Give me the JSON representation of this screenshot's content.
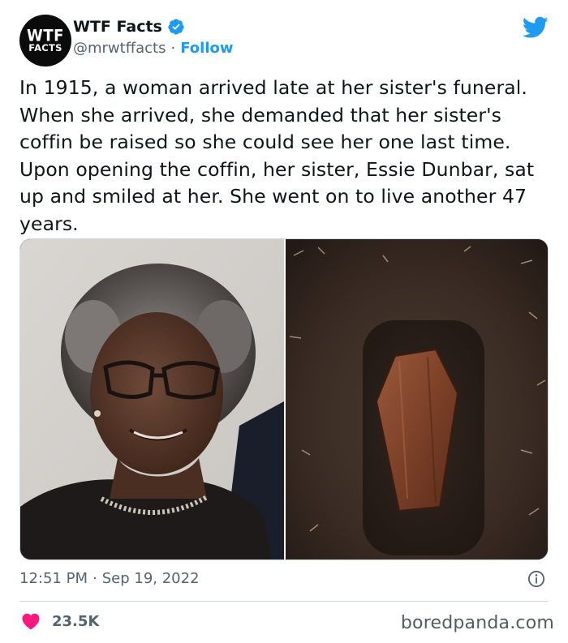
{
  "account": {
    "avatar_line1": "WTF",
    "avatar_line2": "FACTS",
    "display_name": "WTF Facts",
    "handle": "@mrwtffacts",
    "separator": "·",
    "follow_label": "Follow"
  },
  "tweet": {
    "text": "In 1915, a woman arrived late at her sister's funeral. When she arrived, she demanded that her sister's coffin be raised so she could see her one last time. Upon opening the coffin, her sister, Essie Dunbar, sat up and smiled at her. She went on to live another 47 years.",
    "time": "12:51 PM",
    "date_separator": "·",
    "date": "Sep 19, 2022",
    "likes": "23.5K"
  },
  "media": {
    "left_image": "portrait-of-elderly-woman",
    "right_image": "coffin-in-grave"
  },
  "icons": {
    "verified": "verified-badge-icon",
    "brand": "twitter-bird-icon",
    "info": "info-icon",
    "like": "heart-icon"
  },
  "colors": {
    "accent": "#1d9bf0",
    "heart": "#f91880",
    "secondary_text": "#536471",
    "border": "#cfd9de"
  },
  "watermark": "boredpanda.com"
}
